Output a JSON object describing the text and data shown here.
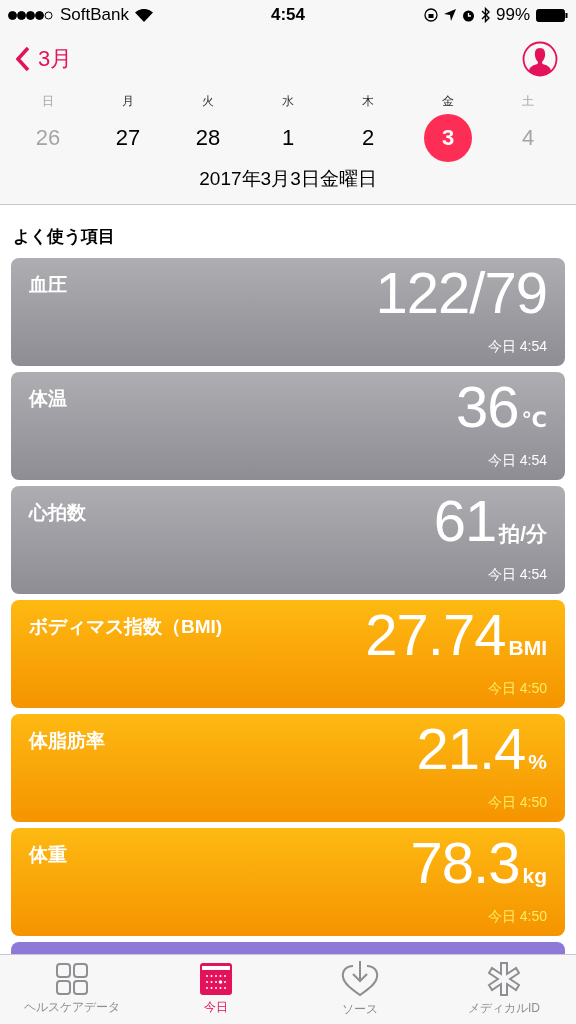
{
  "status_bar": {
    "carrier": "SoftBank",
    "time": "4:54",
    "battery": "99%"
  },
  "nav": {
    "back_label": "3月"
  },
  "week": [
    {
      "weekday": "日",
      "day": "26",
      "weekend": true,
      "selected": false
    },
    {
      "weekday": "月",
      "day": "27",
      "weekend": false,
      "selected": false
    },
    {
      "weekday": "火",
      "day": "28",
      "weekend": false,
      "selected": false
    },
    {
      "weekday": "水",
      "day": "1",
      "weekend": false,
      "selected": false
    },
    {
      "weekday": "木",
      "day": "2",
      "weekend": false,
      "selected": false
    },
    {
      "weekday": "金",
      "day": "3",
      "weekend": false,
      "selected": true
    },
    {
      "weekday": "土",
      "day": "4",
      "weekend": true,
      "selected": false
    }
  ],
  "date_title": "2017年3月3日金曜日",
  "section_title": "よく使う項目",
  "cards": [
    {
      "kind": "vitals",
      "title": "血圧",
      "value": "122/79",
      "time": "今日 4:54"
    },
    {
      "kind": "vitals",
      "title": "体温",
      "value": "36",
      "unit": "℃",
      "time": "今日 4:54"
    },
    {
      "kind": "vitals",
      "title": "心拍数",
      "value": "61",
      "unit": "拍/分",
      "time": "今日 4:54"
    },
    {
      "kind": "body",
      "title": "ボディマス指数（BMI)",
      "value": "27.74",
      "unit": "BMI",
      "time": "今日 4:50"
    },
    {
      "kind": "body",
      "title": "体脂肪率",
      "value": "21.4",
      "unit": "%",
      "time": "今日 4:50"
    },
    {
      "kind": "body",
      "title": "体重",
      "value": "78.3",
      "unit": "kg",
      "time": "今日 4:50"
    },
    {
      "kind": "activity"
    }
  ],
  "tabs": [
    {
      "kind": "grid",
      "label": "ヘルスケアデータ",
      "selected": false
    },
    {
      "kind": "calendar",
      "label": "今日",
      "selected": true
    },
    {
      "kind": "heart",
      "label": "ソース",
      "selected": false
    },
    {
      "kind": "asterisk",
      "label": "メディカルID",
      "selected": false
    }
  ]
}
